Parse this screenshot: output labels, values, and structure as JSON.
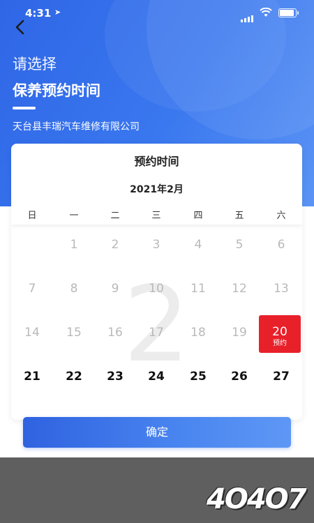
{
  "status_bar": {
    "time": "4:31"
  },
  "header": {
    "prompt": "请选择",
    "title": "保养预约时间",
    "company": "天台县丰瑞汽车维修有限公司"
  },
  "calendar": {
    "title": "预约时间",
    "month": "2021年2月",
    "watermark": "2",
    "weekdays": [
      "日",
      "一",
      "二",
      "三",
      "四",
      "五",
      "六"
    ],
    "weeks": [
      [
        {
          "label": "",
          "state": "empty"
        },
        {
          "label": "1",
          "state": "disabled"
        },
        {
          "label": "2",
          "state": "disabled"
        },
        {
          "label": "3",
          "state": "disabled"
        },
        {
          "label": "4",
          "state": "disabled"
        },
        {
          "label": "5",
          "state": "disabled"
        },
        {
          "label": "6",
          "state": "disabled"
        }
      ],
      [
        {
          "label": "7",
          "state": "disabled"
        },
        {
          "label": "8",
          "state": "disabled"
        },
        {
          "label": "9",
          "state": "disabled"
        },
        {
          "label": "10",
          "state": "disabled"
        },
        {
          "label": "11",
          "state": "disabled"
        },
        {
          "label": "12",
          "state": "disabled"
        },
        {
          "label": "13",
          "state": "disabled"
        }
      ],
      [
        {
          "label": "14",
          "state": "disabled"
        },
        {
          "label": "15",
          "state": "disabled"
        },
        {
          "label": "16",
          "state": "disabled"
        },
        {
          "label": "17",
          "state": "disabled"
        },
        {
          "label": "18",
          "state": "disabled"
        },
        {
          "label": "19",
          "state": "disabled"
        },
        {
          "label": "20",
          "state": "selected",
          "tag": "预约"
        }
      ],
      [
        {
          "label": "21",
          "state": "available"
        },
        {
          "label": "22",
          "state": "available"
        },
        {
          "label": "23",
          "state": "available"
        },
        {
          "label": "24",
          "state": "available"
        },
        {
          "label": "25",
          "state": "available"
        },
        {
          "label": "26",
          "state": "available"
        },
        {
          "label": "27",
          "state": "available"
        }
      ]
    ]
  },
  "confirm_label": "确定",
  "logo_text": "4O4O7",
  "colors": {
    "accent": "#2f66e6",
    "selected": "#e8202a",
    "footer": "#5f5f5f"
  },
  "icons": {
    "back": "chevron-left-icon",
    "wifi": "wifi-icon",
    "battery": "battery-icon",
    "signal": "signal-icon",
    "location": "location-arrow-icon"
  }
}
